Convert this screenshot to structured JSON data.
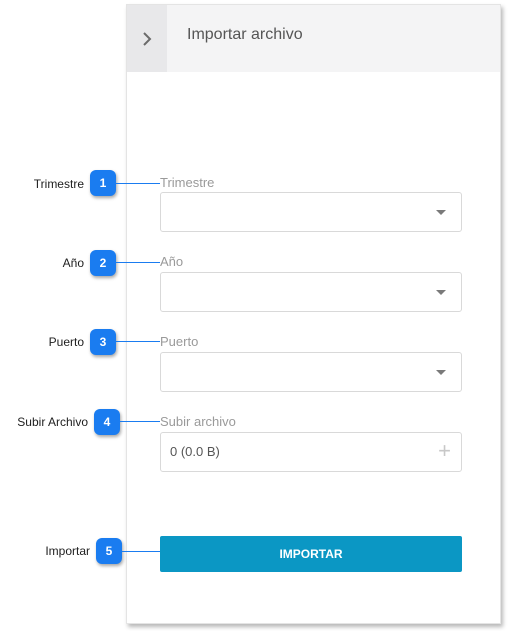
{
  "panel": {
    "title": "Importar archivo",
    "toggle_icon": "chevron-right-icon"
  },
  "fields": {
    "trimestre": {
      "label": "Trimestre",
      "value": ""
    },
    "anio": {
      "label": "Año",
      "value": ""
    },
    "puerto": {
      "label": "Puerto",
      "value": ""
    },
    "subir_archivo": {
      "label": "Subir archivo",
      "value": "0 (0.0 B)",
      "add_symbol": "+"
    }
  },
  "import_button": {
    "label": "IMPORTAR"
  },
  "callouts": [
    {
      "number": "1",
      "text": "Trimestre"
    },
    {
      "number": "2",
      "text": "Año"
    },
    {
      "number": "3",
      "text": "Puerto"
    },
    {
      "number": "4",
      "text": "Subir Archivo"
    },
    {
      "number": "5",
      "text": "Importar"
    }
  ],
  "colors": {
    "accent_button": "#0b97c4",
    "callout_badge": "#1a7cf0",
    "header_bg": "#f4f4f5"
  }
}
